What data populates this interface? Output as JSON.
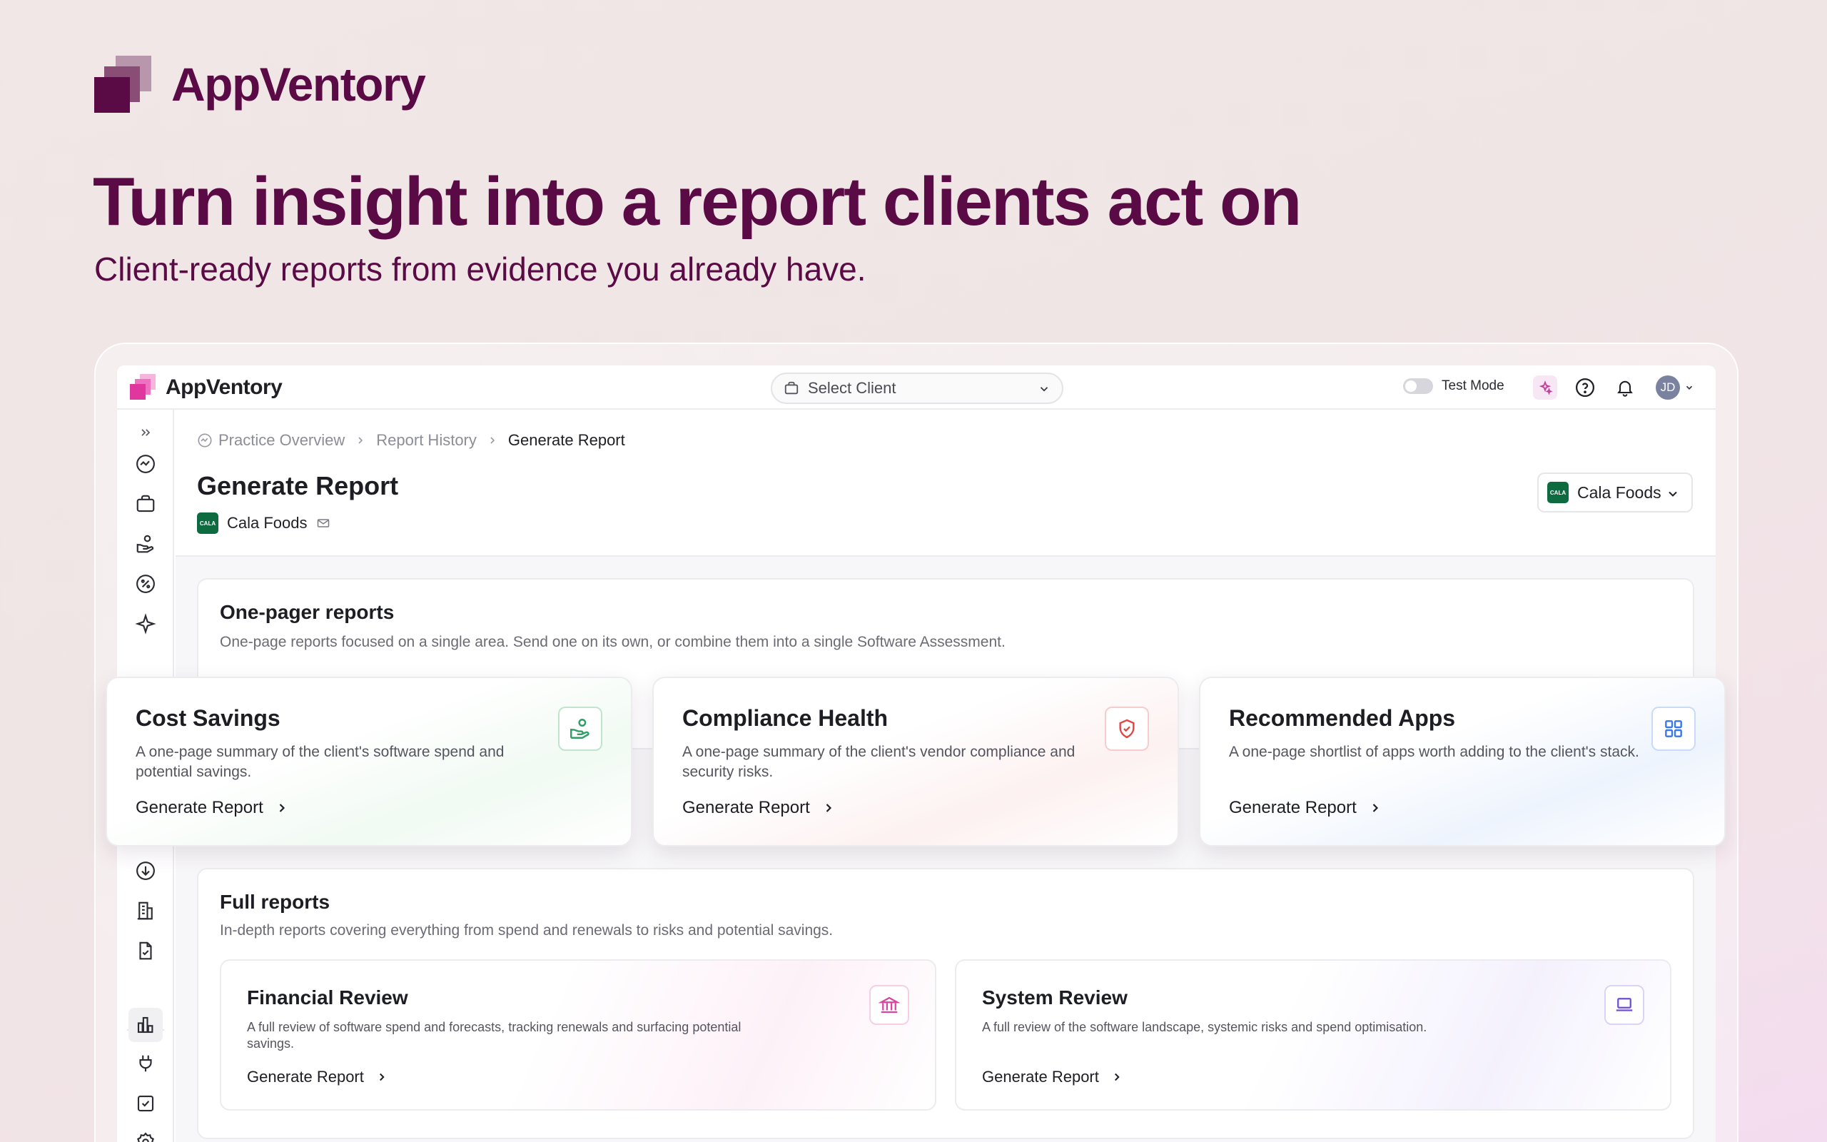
{
  "hero": {
    "brand": "AppVentory",
    "title": "Turn insight into a report clients act on",
    "subtitle": "Client-ready reports from evidence you already have."
  },
  "topbar": {
    "app_name": "AppVentory",
    "client_select_placeholder": "Select Client",
    "test_mode_label": "Test Mode",
    "avatar_initials": "JD"
  },
  "breadcrumb": {
    "items": [
      "Practice Overview",
      "Report History"
    ],
    "current": "Generate Report"
  },
  "page": {
    "title": "Generate Report",
    "client_name": "Cala Foods",
    "client_logo_text": "CALA"
  },
  "client_dropdown": {
    "selected": "Cala Foods",
    "logo_text": "CALA"
  },
  "one_pager": {
    "title": "One-pager reports",
    "description": "One-page reports focused on a single area. Send one on its own, or combine them into a single Software Assessment.",
    "cards": [
      {
        "title": "Cost Savings",
        "description": "A one-page summary of the client's software spend and potential savings.",
        "cta": "Generate Report",
        "icon": "hand-coins-icon",
        "accent": "#2f9e63"
      },
      {
        "title": "Compliance Health",
        "description": "A one-page summary of the client's vendor compliance and security risks.",
        "cta": "Generate Report",
        "icon": "shield-check-icon",
        "accent": "#e04646"
      },
      {
        "title": "Recommended Apps",
        "description": "A one-page shortlist of apps worth adding to the client's stack.",
        "cta": "Generate Report",
        "icon": "grid-icon",
        "accent": "#3b78e7"
      }
    ]
  },
  "full_reports": {
    "title": "Full reports",
    "description": "In-depth reports covering everything from spend and renewals to risks and potential savings.",
    "cards": [
      {
        "title": "Financial Review",
        "description": "A full review of software spend and forecasts, tracking renewals and surfacing potential savings.",
        "cta": "Generate Report",
        "icon": "bank-icon",
        "accent": "#d6459e"
      },
      {
        "title": "System Review",
        "description": "A full review of the software landscape, systemic risks and spend optimisation.",
        "cta": "Generate Report",
        "icon": "laptop-icon",
        "accent": "#6b4fd8"
      }
    ]
  }
}
